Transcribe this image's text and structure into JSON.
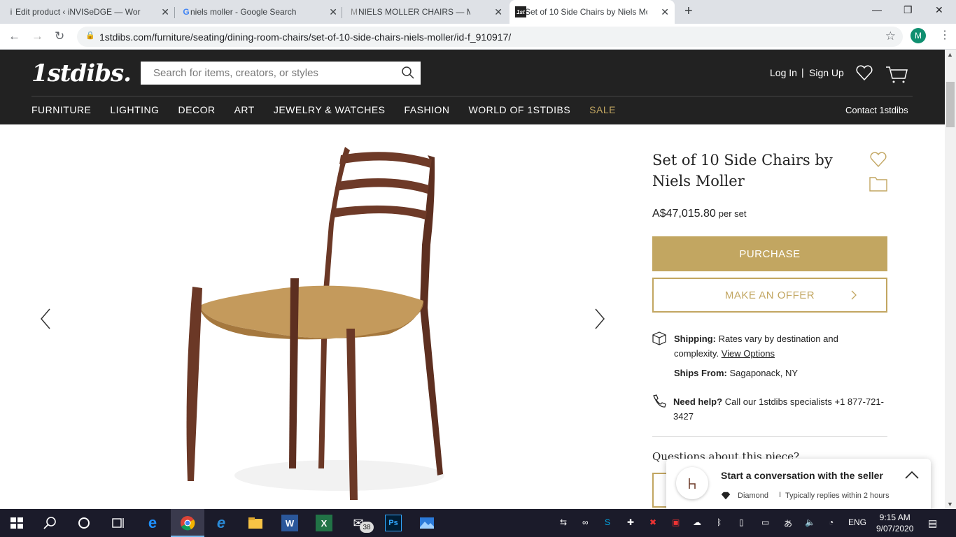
{
  "browser": {
    "tabs": [
      {
        "icon": "i",
        "title": "Edit product ‹ iNVISeDGE — Wor"
      },
      {
        "icon": "G",
        "title": "niels moller - Google Search"
      },
      {
        "icon": "M",
        "title": "NIELS MOLLER CHAIRS — MATTH"
      },
      {
        "icon": "1st",
        "title": "Set of 10 Side Chairs by Niels Mo"
      }
    ],
    "url": "1stdibs.com/furniture/seating/dining-room-chairs/set-of-10-side-chairs-niels-moller/id-f_910917/",
    "profile_initial": "M"
  },
  "site": {
    "logo": "1stdibs.",
    "search_placeholder": "Search for items, creators, or styles",
    "login": "Log In",
    "signup": "Sign Up",
    "nav": [
      "FURNITURE",
      "LIGHTING",
      "DECOR",
      "ART",
      "JEWELRY & WATCHES",
      "FASHION",
      "WORLD OF 1STDIBS",
      "SALE"
    ],
    "contact": "Contact 1stdibs",
    "accent_color": "#c2a661"
  },
  "product": {
    "title": "Set of 10 Side Chairs by Niels Moller",
    "price": "A$47,015.80",
    "price_unit": "per set",
    "purchase_label": "PURCHASE",
    "offer_label": "MAKE AN OFFER",
    "shipping_label": "Shipping:",
    "shipping_text": "Rates vary by destination and complexity.",
    "view_options": "View Options",
    "ships_from_label": "Ships From:",
    "ships_from": "Sagaponack, NY",
    "help_label": "Need help?",
    "help_text": "Call our 1stdibs specialists +1 877-721-3427",
    "questions": "Questions about this piece?"
  },
  "chat": {
    "title": "Start a conversation with the seller",
    "tier": "Diamond",
    "separator": "I",
    "reply": "Typically replies within 2 hours"
  },
  "taskbar": {
    "mail_badge": "38",
    "language": "ENG",
    "time": "9:15 AM",
    "date": "9/07/2020"
  }
}
